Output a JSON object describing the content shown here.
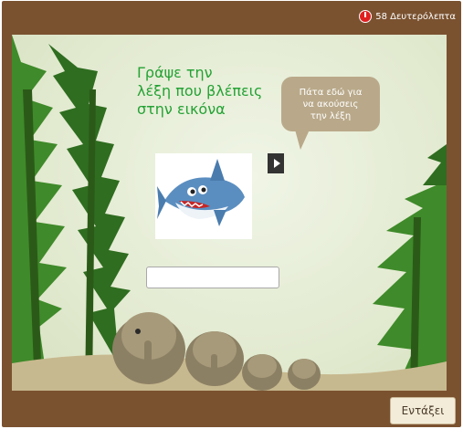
{
  "timer": {
    "text": "58 Δευτερόλεπτα",
    "icon": "timer-icon"
  },
  "instruction": {
    "text": "Γράψε την\nλέξη που  βλέπεις\nστην εικόνα"
  },
  "hint_bubble": {
    "text": "Πάτα εδώ για\nνα ακούσεις\nτην λέξη"
  },
  "picture": {
    "subject": "shark"
  },
  "audio": {
    "icon": "play-icon"
  },
  "answer_field": {
    "value": "",
    "placeholder": ""
  },
  "footer": {
    "ok_label": "Εντάξει"
  },
  "colors": {
    "frame": "#7a5230",
    "stage": "#e6edd6",
    "title": "#25a235",
    "bubble": "#b9a98a",
    "timer": "#e02020"
  }
}
